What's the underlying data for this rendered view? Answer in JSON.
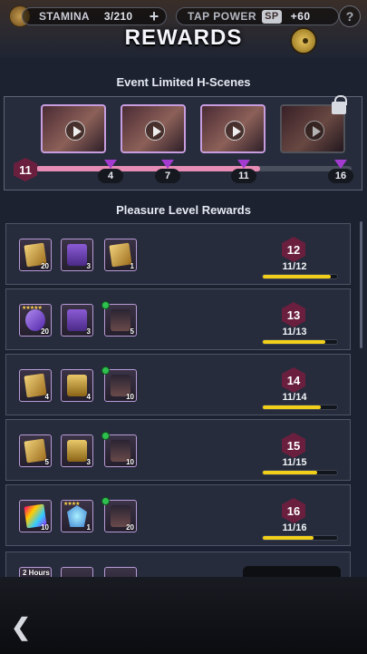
{
  "header": {
    "stamina_label": "STAMINA",
    "stamina_value": "3/210",
    "tap_power_label": "TAP POWER",
    "sp_badge": "SP",
    "tap_power_value": "+60",
    "help_icon": "?",
    "title": "REWARDS"
  },
  "event": {
    "title": "Event Limited H-Scenes",
    "current_level": "11",
    "progress_fraction": 0.71,
    "markers": [
      "4",
      "7",
      "11",
      "16"
    ],
    "scenes": [
      {
        "name": "scene-1",
        "locked": false
      },
      {
        "name": "scene-2",
        "locked": false
      },
      {
        "name": "scene-3",
        "locked": false
      },
      {
        "name": "scene-4",
        "locked": true
      }
    ]
  },
  "rewards": {
    "title": "Pleasure Level Rewards",
    "rows": [
      {
        "level": "12",
        "progress": "11/12",
        "fraction": 0.917,
        "items": [
          {
            "icon": "gold-card",
            "qty": "20"
          },
          {
            "icon": "chest-purple",
            "qty": "3"
          },
          {
            "icon": "gold-card",
            "qty": "1"
          }
        ]
      },
      {
        "level": "13",
        "progress": "11/13",
        "fraction": 0.846,
        "items": [
          {
            "icon": "purple-card",
            "qty": "20",
            "stars": "★★★★★"
          },
          {
            "icon": "chest-purple",
            "qty": "3"
          },
          {
            "icon": "portrait",
            "qty": "5",
            "gem": true
          }
        ]
      },
      {
        "level": "14",
        "progress": "11/14",
        "fraction": 0.786,
        "items": [
          {
            "icon": "gold-card",
            "qty": "4"
          },
          {
            "icon": "chest-gold",
            "qty": "4"
          },
          {
            "icon": "portrait",
            "qty": "10",
            "gem": true
          }
        ]
      },
      {
        "level": "15",
        "progress": "11/15",
        "fraction": 0.733,
        "items": [
          {
            "icon": "gold-card",
            "qty": "5"
          },
          {
            "icon": "chest-gold",
            "qty": "3"
          },
          {
            "icon": "portrait",
            "qty": "10",
            "gem": true
          }
        ]
      },
      {
        "level": "16",
        "progress": "11/16",
        "fraction": 0.688,
        "items": [
          {
            "icon": "rainbow-card",
            "qty": "10"
          },
          {
            "icon": "badge-crystal",
            "qty": "1",
            "stars": "★★★★"
          },
          {
            "icon": "portrait",
            "qty": "20",
            "gem": true
          }
        ]
      }
    ],
    "partial_row_label": "2 Hours"
  },
  "nav": {
    "back_icon": "back-arrow-icon"
  }
}
